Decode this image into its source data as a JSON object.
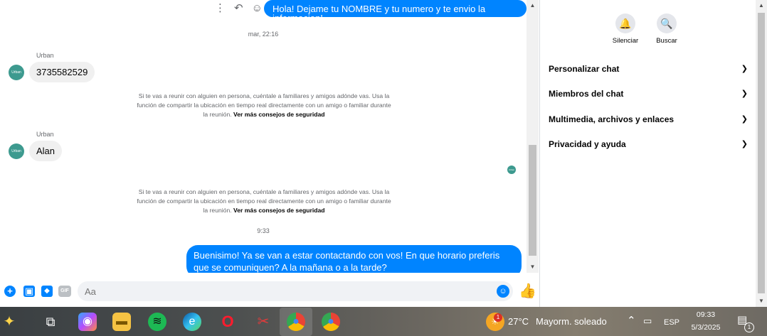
{
  "chat": {
    "hover_actions": {
      "more": "⋮",
      "reply": "↶",
      "react": "☺"
    },
    "messages": [
      {
        "type": "out",
        "text": "Hola! Dejame tu NOMBRE y tu numero y te envio la informacion!"
      },
      {
        "type": "time",
        "text": "mar, 22:16"
      },
      {
        "type": "in",
        "sender": "Urban",
        "text": "3735582529"
      },
      {
        "type": "in",
        "sender": "Urban",
        "text": "Alan"
      },
      {
        "type": "time",
        "text": "9:33"
      },
      {
        "type": "out",
        "text": "Buenisimo! Ya se van a estar contactando con vos! En que horario preferis que se comuniquen? A la mañana o a la tarde?"
      }
    ],
    "notice": {
      "text": "Si te vas a reunir con alguien en persona, cuéntale a familiares y amigos adónde vas. Usa la función de compartir la ubicación en tiempo real directamente con un amigo o familiar durante la reunión. ",
      "link": "Ver más consejos de seguridad"
    },
    "avatar_text": "Urban Dental"
  },
  "composer": {
    "placeholder": "Aa",
    "gif_label": "GIF"
  },
  "info_panel": {
    "actions": [
      {
        "label": "Silenciar",
        "icon": "bell-icon"
      },
      {
        "label": "Buscar",
        "icon": "search-icon"
      }
    ],
    "sections": [
      {
        "label": "Personalizar chat"
      },
      {
        "label": "Miembros del chat"
      },
      {
        "label": "Multimedia, archivos y enlaces"
      },
      {
        "label": "Privacidad y ayuda"
      }
    ]
  },
  "taskbar": {
    "weather": {
      "temp": "27°C",
      "condition": "Mayorm. soleado",
      "badge": "1"
    },
    "language": "ESP",
    "clock": {
      "time": "09:33",
      "date": "5/3/2025"
    },
    "notification_count": "1",
    "colors": {
      "accent": "#0084ff"
    }
  }
}
